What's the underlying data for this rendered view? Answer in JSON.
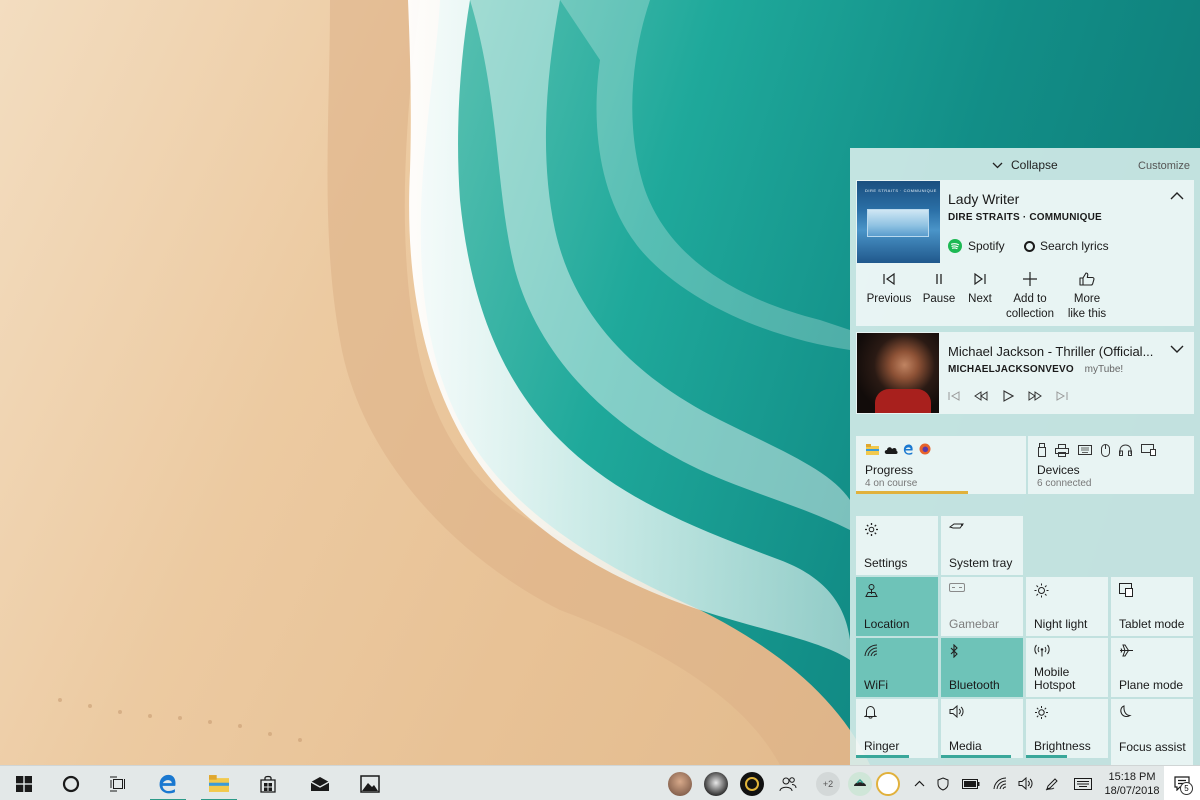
{
  "action_center": {
    "collapse_label": "Collapse",
    "customize_label": "Customize"
  },
  "now_playing": {
    "title": "Lady Writer",
    "artist_album": "DIRE STRAITS · COMMUNIQUE",
    "album_art_text": "DIRE STRAITS · COMMUNIQUE",
    "source": "Spotify",
    "search_lyrics": "Search lyrics",
    "controls": [
      {
        "label": "Previous"
      },
      {
        "label": "Pause"
      },
      {
        "label": "Next"
      },
      {
        "label_1": "Add to",
        "label_2": "collection"
      },
      {
        "label_1": "More",
        "label_2": "like this"
      }
    ]
  },
  "second_media": {
    "title": "Michael Jackson - Thriller (Official...",
    "channel": "MICHAELJACKSONVEVO",
    "app": "myTube!"
  },
  "progress": {
    "title": "Progress",
    "subtitle": "4 on course"
  },
  "devices": {
    "title": "Devices",
    "subtitle": "6 connected"
  },
  "tiles": [
    {
      "label": "Settings",
      "icon": "gear-icon",
      "state": "off"
    },
    {
      "label": "System tray",
      "icon": "tray-icon",
      "state": "off"
    },
    {
      "label": "Location",
      "icon": "location-icon",
      "state": "on"
    },
    {
      "label": "Gamebar",
      "icon": "gamebar-icon",
      "state": "disabled"
    },
    {
      "label": "Night light",
      "icon": "night-light-icon",
      "state": "off"
    },
    {
      "label": "Tablet mode",
      "icon": "tablet-mode-icon",
      "state": "off"
    },
    {
      "label": "WiFi",
      "icon": "wifi-icon",
      "state": "on"
    },
    {
      "label": "Bluetooth",
      "icon": "bluetooth-icon",
      "state": "on"
    },
    {
      "label_1": "Mobile",
      "label_2": "Hotspot",
      "icon": "hotspot-icon",
      "state": "off"
    },
    {
      "label": "Plane mode",
      "icon": "plane-icon",
      "state": "off"
    },
    {
      "label": "Ringer",
      "icon": "bell-icon",
      "state": "off",
      "level": 0.65
    },
    {
      "label": "Media",
      "icon": "speaker-icon",
      "state": "off",
      "level": 0.85
    },
    {
      "label": "Brightness",
      "icon": "brightness-icon",
      "state": "off",
      "level": 0.5
    },
    {
      "label": "Focus assist",
      "icon": "moon-icon",
      "state": "off"
    }
  ],
  "taskbar": {
    "people_overflow": "+2",
    "clock_time": "15:18 PM",
    "clock_date": "18/07/2018",
    "notification_count": "5"
  },
  "colors": {
    "accent_tile": "#6ec3b8",
    "accent_bar": "#2c9a88",
    "progress_bar": "#e1b13c",
    "spotify_green": "#1db954"
  }
}
